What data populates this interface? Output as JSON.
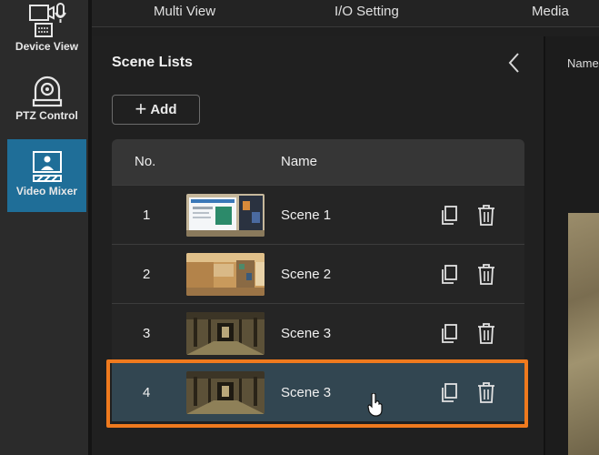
{
  "rail": {
    "items": [
      {
        "label": "Device View",
        "icon": "device-view-icon"
      },
      {
        "label": "PTZ Control",
        "icon": "ptz-camera-icon"
      },
      {
        "label": "Video Mixer",
        "icon": "video-mixer-icon",
        "active": true
      }
    ]
  },
  "topbar": {
    "tabs": [
      "Multi View",
      "I/O Setting",
      "Media"
    ]
  },
  "panel": {
    "title": "Scene Lists",
    "add_label": "Add",
    "columns": {
      "no": "No.",
      "name": "Name"
    },
    "rows": [
      {
        "no": "1",
        "name": "Scene 1",
        "thumb": "webpage"
      },
      {
        "no": "2",
        "name": "Scene 2",
        "thumb": "room"
      },
      {
        "no": "3",
        "name": "Scene 3",
        "thumb": "corridor"
      },
      {
        "no": "4",
        "name": "Scene 3",
        "thumb": "corridor",
        "selected": true
      }
    ]
  },
  "right": {
    "header": "Name"
  },
  "colors": {
    "accent": "#1f6e98",
    "selection_frame": "#ef7a1e",
    "selected_row": "#324651"
  }
}
